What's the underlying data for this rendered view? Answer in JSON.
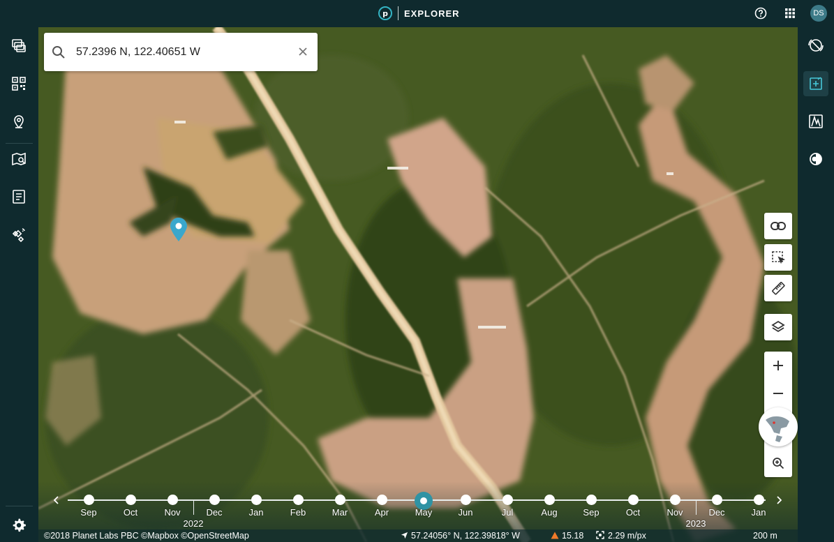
{
  "app": {
    "title": "EXPLORER",
    "logo_letter": "p",
    "user_initials": "DS"
  },
  "search": {
    "value": "57.2396 N, 122.40651 W",
    "placeholder": ""
  },
  "leftbar": {
    "items": [
      {
        "icon": "imagery-stack-icon"
      },
      {
        "icon": "mosaic-grid-icon"
      },
      {
        "icon": "places-pin-icon"
      },
      {
        "icon": "map-tasks-icon"
      },
      {
        "icon": "orders-list-icon"
      },
      {
        "icon": "tasking-satellite-icon"
      }
    ],
    "settings_icon": "gear-icon"
  },
  "rightbar": {
    "items": [
      {
        "icon": "no-data-scan-icon",
        "active": false
      },
      {
        "icon": "analysis-add-icon",
        "active": true
      },
      {
        "icon": "terrain-3d-icon",
        "active": false
      },
      {
        "icon": "contrast-icon",
        "active": false
      }
    ]
  },
  "map_tools": [
    "link-icon",
    "select-area-icon",
    "ruler-icon",
    "layers-icon",
    "plus-icon",
    "minus-icon",
    "globe-icon",
    "zoom-search-icon"
  ],
  "timeline": {
    "months": [
      "Sep",
      "Oct",
      "Nov",
      "Dec",
      "Jan",
      "Feb",
      "Mar",
      "Apr",
      "May",
      "Jun",
      "Jul",
      "Aug",
      "Sep",
      "Oct",
      "Nov",
      "Dec",
      "Jan"
    ],
    "active_index": 8,
    "years": [
      {
        "label": "2022",
        "after_index": 2
      },
      {
        "label": "2023",
        "after_index": 14
      }
    ]
  },
  "footer": {
    "attribution": "©2018 Planet Labs PBC ©Mapbox ©OpenStreetMap",
    "cursor_coords": "57.24056° N, 122.39818° W",
    "sun_elevation": "15.18",
    "resolution": "2.29 m/px",
    "scale": "200 m"
  },
  "colors": {
    "accent": "#2f93a4",
    "chrome": "#0f2a2e",
    "pin": "#3aa7cc",
    "warning": "#f07a2a"
  }
}
